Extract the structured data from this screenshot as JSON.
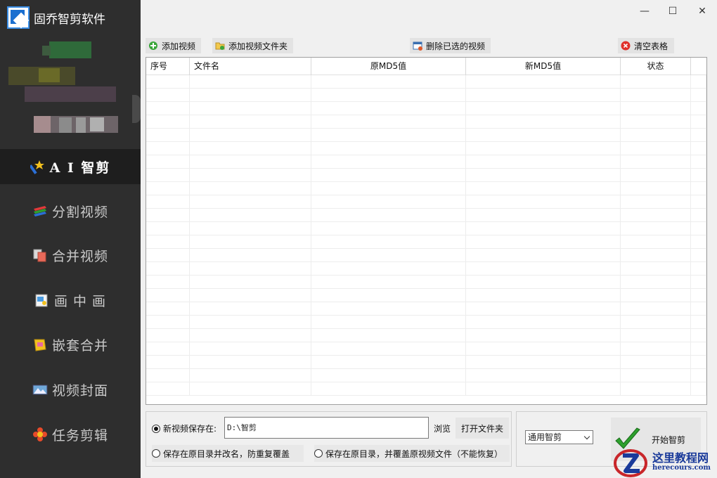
{
  "app": {
    "title": "固乔智剪软件"
  },
  "window_controls": {
    "minimize": "—",
    "maximize": "☐",
    "close": "✕"
  },
  "sidebar": {
    "items": [
      {
        "label": "A I 智剪",
        "icon": "magic-wand-icon",
        "active": true
      },
      {
        "label": "分割视频",
        "icon": "split-layers-icon",
        "active": false
      },
      {
        "label": "合并视频",
        "icon": "merge-frames-icon",
        "active": false
      },
      {
        "label": "画 中 画",
        "icon": "picture-in-picture-icon",
        "active": false
      },
      {
        "label": "嵌套合并",
        "icon": "nest-box-icon",
        "active": false
      },
      {
        "label": "视频封面",
        "icon": "cover-image-icon",
        "active": false
      },
      {
        "label": "任务剪辑",
        "icon": "flower-gear-icon",
        "active": false
      }
    ]
  },
  "toolbar": {
    "add_video": "添加视频",
    "add_folder": "添加视频文件夹",
    "delete_selected": "删除已选的视频",
    "clear_table": "清空表格"
  },
  "table": {
    "columns": [
      "序号",
      "文件名",
      "原MD5值",
      "新MD5值",
      "状态"
    ],
    "rows": []
  },
  "save": {
    "new_location_label": "新视频保存在:",
    "path_value": "D:\\智剪",
    "browse": "浏览",
    "open_folder": "打开文件夹",
    "option_rename": "保存在原目录并改名，防重复覆盖",
    "option_overwrite": "保存在原目录，并覆盖原视频文件（不能恢复）",
    "selected_option": "new_location"
  },
  "mode": {
    "selected": "通用智剪"
  },
  "start_button": {
    "label": "开始智剪"
  },
  "watermark": {
    "title": "这里教程网",
    "site": "herecours.com"
  },
  "colors": {
    "sidebar_bg": "#2e2e2e",
    "sidebar_active_bg": "#1e1e1e",
    "accent_blue": "#1a6fd0",
    "check_green": "#2ea02e"
  }
}
